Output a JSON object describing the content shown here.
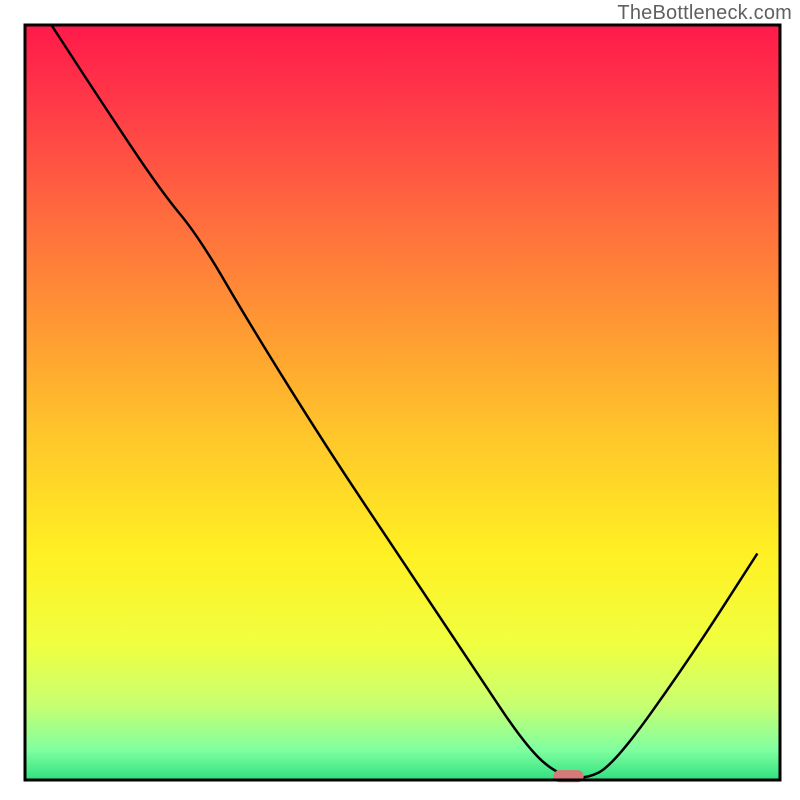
{
  "watermark": "TheBottleneck.com",
  "chart_data": {
    "type": "line",
    "title": "",
    "xlabel": "",
    "ylabel": "",
    "xlim": [
      0,
      100
    ],
    "ylim": [
      0,
      100
    ],
    "background_gradient": {
      "stops": [
        {
          "offset": 0.0,
          "color": "#ff1a4a"
        },
        {
          "offset": 0.1,
          "color": "#ff3848"
        },
        {
          "offset": 0.25,
          "color": "#ff6a3e"
        },
        {
          "offset": 0.4,
          "color": "#ff9933"
        },
        {
          "offset": 0.55,
          "color": "#ffc82a"
        },
        {
          "offset": 0.7,
          "color": "#fff023"
        },
        {
          "offset": 0.82,
          "color": "#f0ff40"
        },
        {
          "offset": 0.9,
          "color": "#c8ff70"
        },
        {
          "offset": 0.96,
          "color": "#80ffa0"
        },
        {
          "offset": 1.0,
          "color": "#30e080"
        }
      ]
    },
    "series": [
      {
        "name": "bottleneck-curve",
        "color": "#000000",
        "x": [
          3.5,
          10,
          18,
          23,
          30,
          40,
          50,
          60,
          66,
          70,
          74,
          78,
          88,
          97
        ],
        "values": [
          100,
          90,
          78,
          72,
          60,
          44,
          29,
          14,
          5,
          1,
          0,
          2,
          16,
          30
        ]
      }
    ],
    "marker": {
      "name": "optimal-point",
      "x": 72,
      "y": 0.5,
      "color": "#d97878",
      "width": 4,
      "height": 1.6
    },
    "axes_visible": false,
    "frame_color": "#000000"
  }
}
